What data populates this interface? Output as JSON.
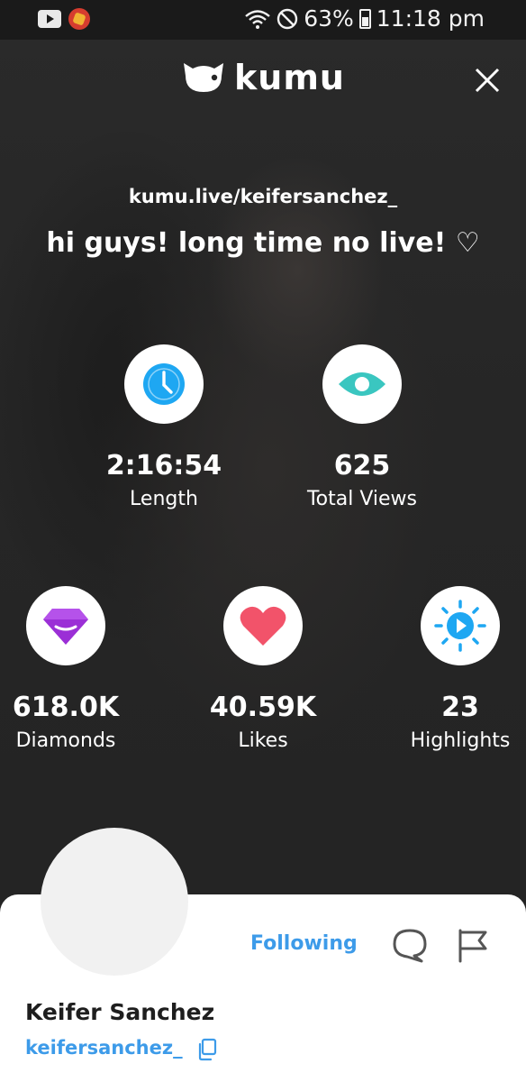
{
  "status_bar": {
    "battery": "63%",
    "time": "11:18 pm",
    "icons": [
      "youtube-icon",
      "app-notification-icon",
      "wifi-icon",
      "do-not-disturb-icon",
      "battery-icon"
    ]
  },
  "header": {
    "logo_text": "kumu",
    "close_icon": "close-icon"
  },
  "stream": {
    "url": "kumu.live/keifersanchez_",
    "title": "hi guys! long time no live! ♡"
  },
  "stats": {
    "length": {
      "value": "2:16:54",
      "label": "Length",
      "icon": "clock-icon",
      "color": "#1ea7f2"
    },
    "views": {
      "value": "625",
      "label": "Total Views",
      "icon": "eye-icon",
      "color": "#3ac6c0"
    },
    "diamonds": {
      "value": "618.0K",
      "label": "Diamonds",
      "icon": "diamond-icon",
      "color": "#9b2fd6"
    },
    "likes": {
      "value": "40.59K",
      "label": "Likes",
      "icon": "heart-icon",
      "color": "#f2536a"
    },
    "highlights": {
      "value": "23",
      "label": "Highlights",
      "icon": "highlight-play-icon",
      "color": "#1ea7f2"
    }
  },
  "profile": {
    "name": "Keifer Sanchez",
    "handle": "keifersanchez_",
    "follow_label": "Following",
    "accent": "#3d9be9"
  }
}
